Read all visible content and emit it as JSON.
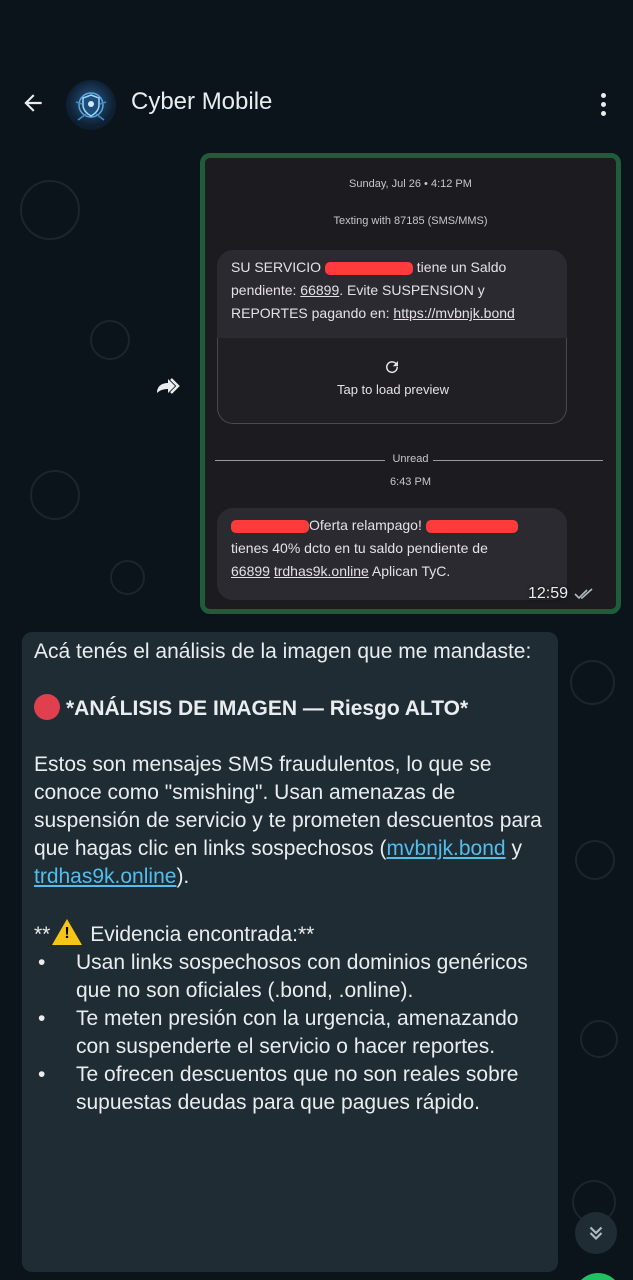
{
  "header": {
    "title": "Cyber Mobile"
  },
  "image_message": {
    "date": "Sunday, Jul 26 • 4:12 PM",
    "texting_with": "Texting with 87185 (SMS/MMS)",
    "sms1": {
      "prefix": "SU SERVICIO",
      "after_redact": "tiene un Saldo",
      "line2_a": "pendiente: ",
      "line2_num": "66899",
      "line2_b": ". Evite SUSPENSION y",
      "line3_a": "REPORTES pagando en: ",
      "line3_link": "https://mvbnjk.bond"
    },
    "preview_label": "Tap to load preview",
    "unread_label": "Unread",
    "time2": "6:43 PM",
    "sms2": {
      "after_redact": "Oferta relampago!",
      "line2": "tienes 40% dcto en tu saldo pendiente de",
      "line3_num": "66899",
      "line3_link": "trdhas9k.online",
      "line3_rest": " Aplican TyC."
    },
    "timestamp": "12:59"
  },
  "reply": {
    "intro": "Acá tenés el análisis de la imagen que me mandaste:",
    "heading": "*ANÁLISIS DE IMAGEN — Riesgo ALTO*",
    "para_a": "Estos son mensajes SMS fraudulentos, lo que se conoce como \"smishing\". Usan amenazas de suspensión de servicio y te prometen descuentos para que hagas clic en links sospechosos (",
    "link1": "mvbnjk.bond",
    "para_mid": " y ",
    "link2": "trdhas9k.online",
    "para_end": ").",
    "evidence_prefix": "**",
    "evidence_label": " Evidencia encontrada:**",
    "bullets": [
      "Usan links sospechosos con dominios genéricos que no son oficiales (.bond, .online).",
      "Te meten presión con la urgencia, amenazando con suspenderte el servicio o hacer reportes.",
      "Te ofrecen descuentos que no son reales sobre supuestas deudas para que pagues rápido."
    ],
    "bullet_char": "•"
  },
  "colors": {
    "background": "#0b141a",
    "bubble_incoming": "#1f2c34",
    "image_border": "#1f5c3a",
    "link": "#53bdeb",
    "redaction": "#ff3b3b",
    "risk_dot": "#e0404e",
    "warning": "#f5c518"
  },
  "icons": [
    "back-arrow-icon",
    "avatar-shield-icon",
    "more-vert-icon",
    "forward-icon",
    "reload-icon",
    "double-check-icon",
    "chevron-double-down-icon"
  ]
}
